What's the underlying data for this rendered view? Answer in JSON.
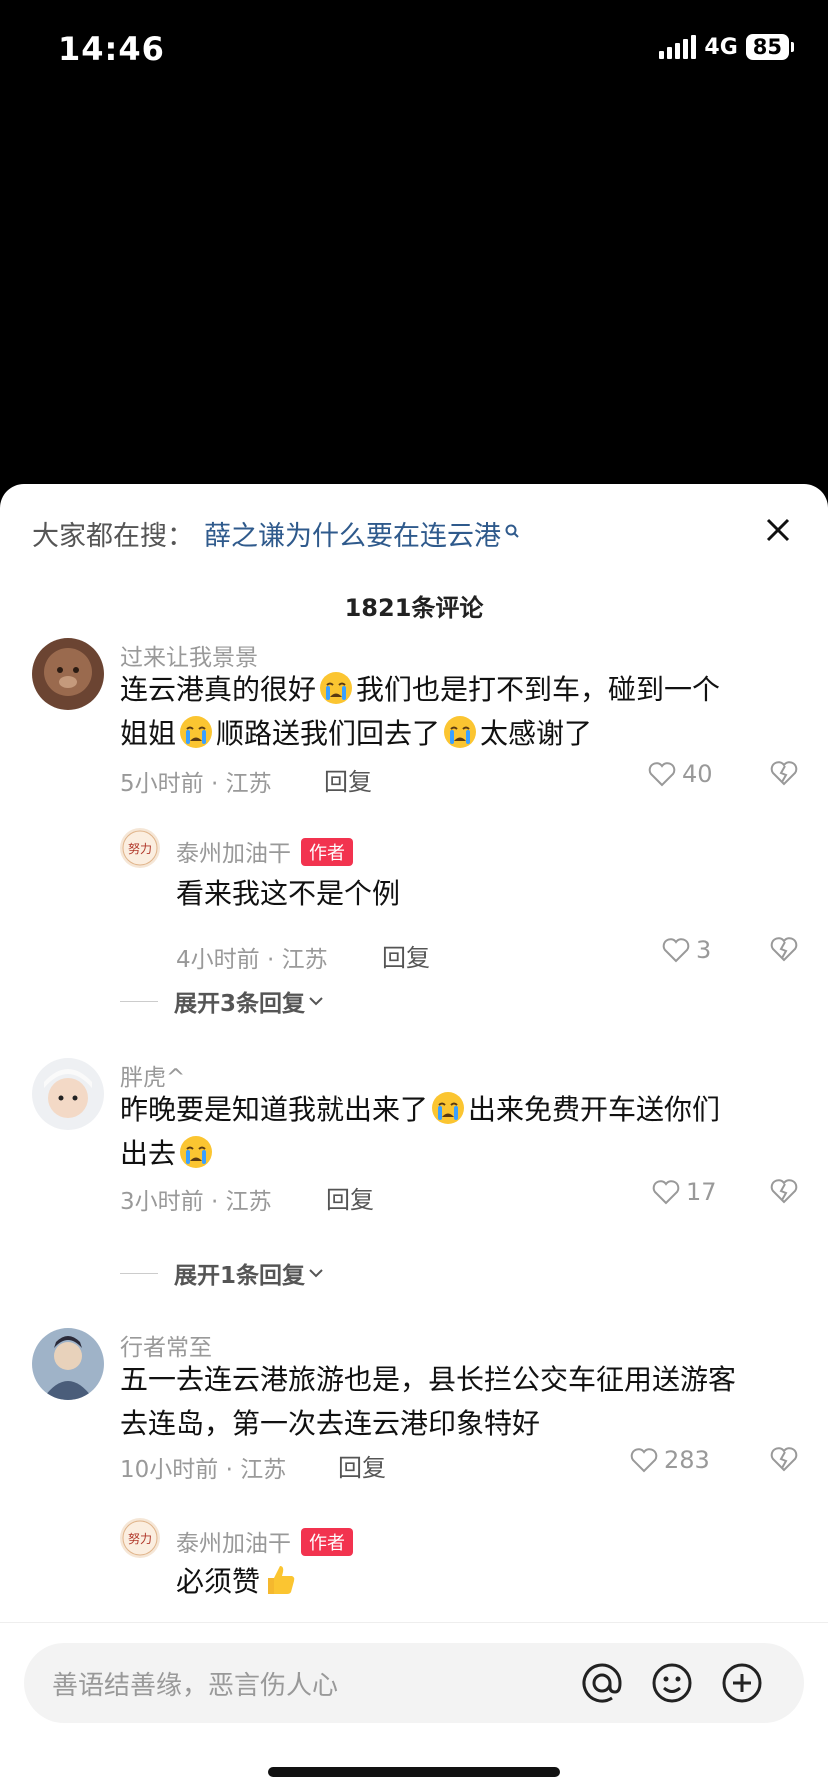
{
  "status": {
    "time": "14:46",
    "network": "4G",
    "battery": "85"
  },
  "hot_search": {
    "prefix": "大家都在搜：",
    "query": "薛之谦为什么要在连云港"
  },
  "comment_count": "1821条评论",
  "comments": [
    {
      "user": "过来让我景景",
      "text_parts": [
        "连云港真的很好",
        "我们也是打不到车，碰到一个",
        "姐姐",
        "顺路送我们回去了",
        "太感谢了"
      ],
      "meta": "5小时前 · 江苏",
      "reply": "回复",
      "likes": "40"
    },
    {
      "user": "泰州加油干",
      "tag": "作者",
      "text": "看来我这不是个例",
      "meta": "4小时前 · 江苏",
      "reply": "回复",
      "likes": "3"
    },
    {
      "user": "胖虎^",
      "text_parts": [
        "昨晚要是知道我就出来了",
        "出来免费开车送你们",
        "出去"
      ],
      "meta": "3小时前 · 江苏",
      "reply": "回复",
      "likes": "17"
    },
    {
      "user": "行者常至",
      "text_line1": "五一去连云港旅游也是，县长拦公交车征用送游客",
      "text_line2": "去连岛，第一次去连云港印象特好",
      "meta": "10小时前 · 江苏",
      "reply": "回复",
      "likes": "283"
    },
    {
      "user": "泰州加油干",
      "tag": "作者",
      "text": "必须赞"
    }
  ],
  "expand_labels": [
    "展开3条回复",
    "展开1条回复"
  ],
  "input": {
    "placeholder": "善语结善缘，恶言伤人心"
  },
  "colors": {
    "author_tag": "#f2334f",
    "hot_query": "#2f5a8c"
  }
}
